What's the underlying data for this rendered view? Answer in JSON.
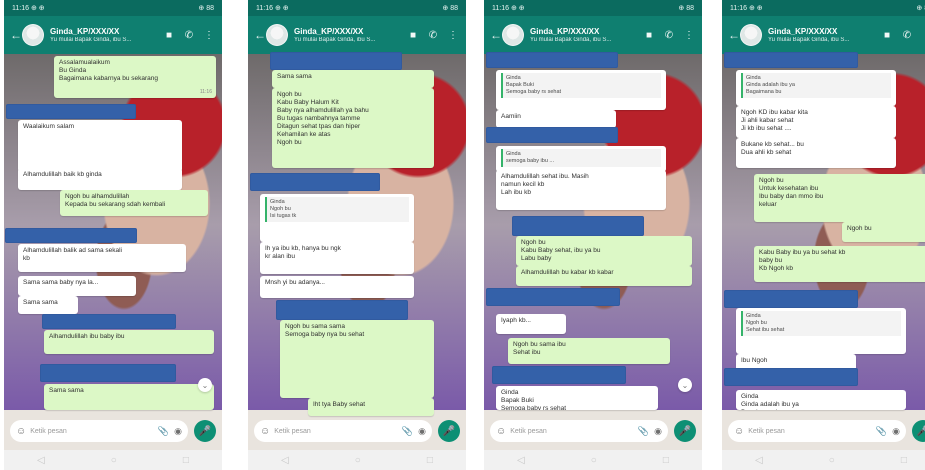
{
  "status": {
    "left": "11:16 ⊕ ⊕",
    "right": "⊕ 88"
  },
  "chat": {
    "name": "Ginda_KP/XXX/XX",
    "subtitle": "Yu mulai Bapak Ginda, ibu S...",
    "input_placeholder": "Ketik pesan"
  },
  "phones": [
    {
      "messages": [
        {
          "text": "Assalamualaikum\nBu Ginda\nBagaimana kabarnya bu sekarang",
          "type": "out"
        },
        {
          "text": "Waalaikum salam",
          "type": "in"
        },
        {
          "text": "Alhamdulillah baik kb ginda",
          "type": "in"
        },
        {
          "text": "Ngoh bu alhamdulillah\nKepada bu sekarang sdah kembali",
          "type": "out"
        },
        {
          "text": "Alhamdulillah balik ad sama sekali\nkb",
          "type": "in"
        },
        {
          "text": "Sama sama baby nya la...",
          "type": "in"
        },
        {
          "text": "Sama sama",
          "type": "in"
        },
        {
          "text": "Alhamdulillah ibu baby ibu",
          "type": "out"
        },
        {
          "text": "Alhamdulillah bu ibu baby ibu",
          "type": "out"
        },
        {
          "text": "Sama sama",
          "type": "out"
        }
      ]
    },
    {
      "messages": [
        {
          "text": "Sama sama",
          "type": "out"
        },
        {
          "text": "Ngoh bu\nKabu Baby Halum Kit\nBaby nya alhamdulillah ya bahu\nBu tugas nambahnya tamme\nDitagun sehat tpas dan hiper\nKehamilan ke atas\nNgoh bu",
          "type": "out"
        },
        {
          "text": "Ginda\nNgoh bu\nIsi tugas tk",
          "type": "in"
        },
        {
          "text": "Ih ya ibu kb, hanya bu ngk\nkr alan ibu ",
          "type": "in"
        },
        {
          "text": "Mnsh yi bu adanya...",
          "type": "in"
        },
        {
          "text": "Ngoh bu sama sama\nSemoga baby nya bu sehat",
          "type": "out"
        },
        {
          "text": "Iht tya Baby sehat",
          "type": "out"
        }
      ]
    },
    {
      "messages": [
        {
          "text": "Ginda\nBapak Buki\nSemoga baby rs sehat",
          "type": "in"
        },
        {
          "text": "Aamiin",
          "type": "in"
        },
        {
          "text": "Ginda\nsemoga baby ibu ...",
          "type": "in"
        },
        {
          "text": "Alhamdulillah sehat ibu. Masih\nnamun kecil kb\nLah ibu kb",
          "type": "in"
        },
        {
          "text": "Ngoh bu\nKabu Baby sehat, ibu ya bu\nLabu baby",
          "type": "out"
        },
        {
          "text": "Alhamdulillah bu kabar kb kabar",
          "type": "out"
        },
        {
          "text": "Iyaph kb...",
          "type": "in"
        },
        {
          "text": "Ngoh bu sama ibu\nSehat ibu",
          "type": "out"
        }
      ]
    },
    {
      "messages": [
        {
          "text": "Ginda\nGinda adalah ibu ya\nBagaimana bu",
          "type": "in"
        },
        {
          "text": "Ngoh KD ibu kabar kita\nJi ahli kabar sehat\nJi kb ibu sehat ....",
          "type": "in"
        },
        {
          "text": "Bukane kb sehat... bu\nDua ahli kb sehat",
          "type": "in"
        },
        {
          "text": "Ngoh bu\nUntuk kesehatan ibu\nIbu baby dan mmo ibu\nkeluar",
          "type": "out"
        },
        {
          "text": "Ngoh bu",
          "type": "out"
        },
        {
          "text": "Kabu Baby ibu ya bu sehat kb\nbaby bu\nKb Ngoh kb",
          "type": "out"
        },
        {
          "text": "Ginda\nNgoh bu\nSehat ibu sehat\n",
          "type": "in"
        },
        {
          "text": "Ibu Ngoh",
          "type": "in"
        }
      ]
    }
  ]
}
